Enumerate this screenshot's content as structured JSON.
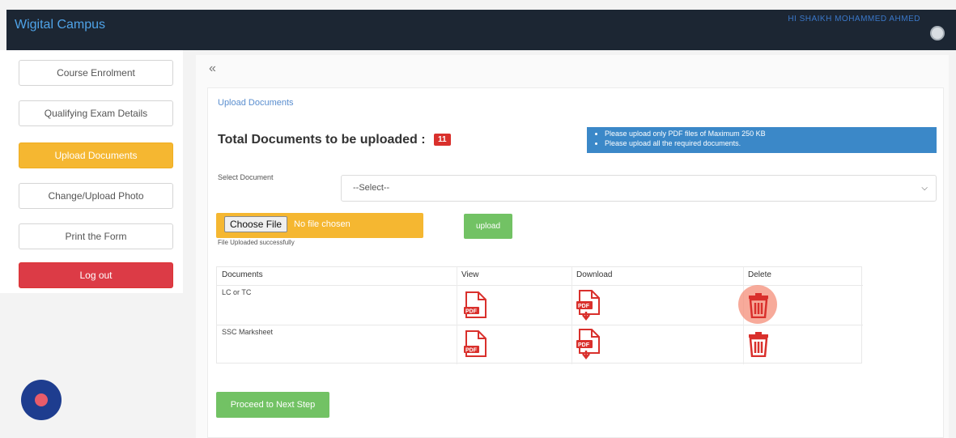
{
  "app": {
    "brand": "Wigital Campus",
    "username": "HI SHAIKH MOHAMMED AHMED"
  },
  "sidebar": {
    "items": [
      {
        "label": "Course Enrolment"
      },
      {
        "label": "Qualifying Exam Details"
      },
      {
        "label": "Upload Documents"
      },
      {
        "label": "Change/Upload Photo"
      },
      {
        "label": "Print the Form"
      },
      {
        "label": "Log out"
      }
    ]
  },
  "main": {
    "collapse_icon": "«",
    "panel_title": "Upload Documents",
    "total_label": "Total Documents to be uploaded :",
    "total_count": "11",
    "info": [
      "Please upload only PDF files of Maximum 250 KB",
      "Please upload all the required documents."
    ],
    "select_label": "Select Document",
    "select_value": "--Select--",
    "file_button": "Choose File",
    "file_status": "No file chosen",
    "upload_status": "File Uploaded successfully",
    "upload_button": "upload",
    "table": {
      "headers": [
        "Documents",
        "View",
        "Download",
        "Delete"
      ],
      "rows": [
        {
          "document": "LC or TC"
        },
        {
          "document": "SSC Marksheet"
        }
      ]
    },
    "proceed_button": "Proceed to Next Step"
  },
  "icons": {
    "view": "pdf-file-icon",
    "download": "pdf-download-icon",
    "delete": "trash-icon",
    "avatar": "avatar-icon",
    "help": "help-fab-icon"
  },
  "colors": {
    "topbar": "#1c2633",
    "accent_orange": "#f5b731",
    "success_green": "#72c264",
    "danger_red": "#dc3b46",
    "info_blue": "#3b88c8",
    "icon_red": "#d9302c"
  }
}
